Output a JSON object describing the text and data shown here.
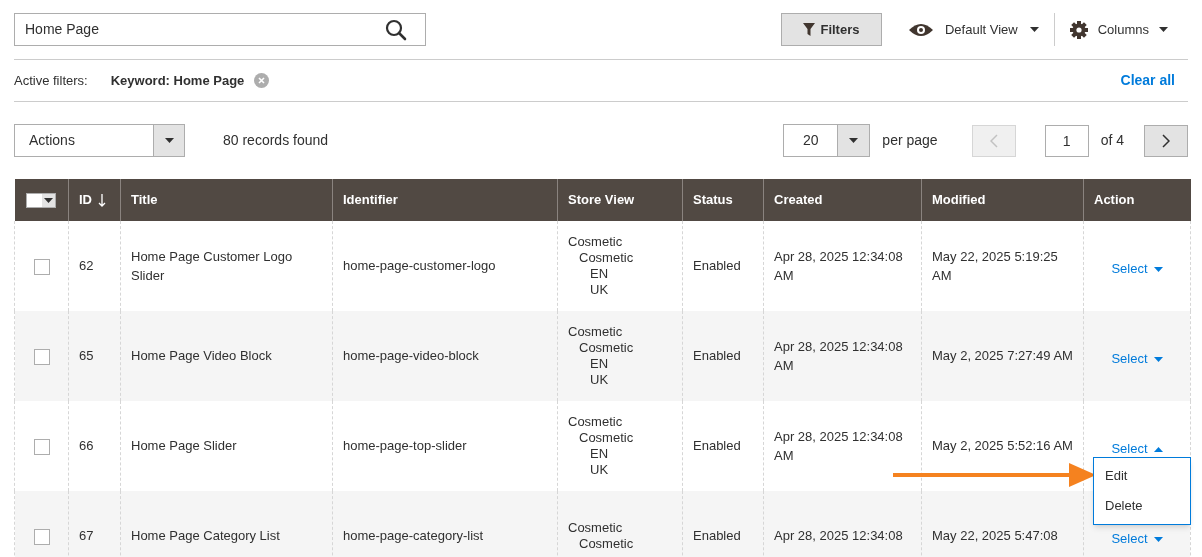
{
  "search": {
    "value": "Home Page"
  },
  "toolbar": {
    "filters": "Filters",
    "view": "Default View",
    "columns": "Columns"
  },
  "active_filters": {
    "label": "Active filters:",
    "chips": [
      {
        "text": "Keyword: Home Page"
      }
    ],
    "clear": "Clear all"
  },
  "actions": {
    "label": "Actions"
  },
  "records": "80 records found",
  "per_page": {
    "value": "20",
    "label": "per page"
  },
  "pager": {
    "prev_disabled": true,
    "next_disabled": false,
    "page": "1",
    "of": "of 4"
  },
  "table": {
    "select_all_checked": false,
    "columns": [
      {
        "label": "ID",
        "sorted": true
      },
      {
        "label": "Title",
        "sorted": false
      },
      {
        "label": "Identifier",
        "sorted": false
      },
      {
        "label": "Store View",
        "sorted": false
      },
      {
        "label": "Status",
        "sorted": false
      },
      {
        "label": "Created",
        "sorted": false
      },
      {
        "label": "Modified",
        "sorted": false
      },
      {
        "label": "Action",
        "sorted": false
      }
    ],
    "rows": [
      {
        "checked": false,
        "id": "62",
        "title": "Home Page Customer Logo Slider",
        "identifier": "home-page-customer-logo",
        "store_view": [
          {
            "label": "Cosmetic",
            "children": [
              {
                "label": "Cosmetic",
                "children": [
                  {
                    "label": "EN"
                  },
                  {
                    "label": "UK"
                  }
                ]
              }
            ]
          }
        ],
        "status": "Enabled",
        "created": "Apr 28, 2025 12:34:08 AM",
        "modified": "May 22, 2025 5:19:25 AM",
        "action": {
          "label": "Select",
          "open": false
        }
      },
      {
        "checked": false,
        "id": "65",
        "title": "Home Page Video Block",
        "identifier": "home-page-video-block",
        "store_view": [
          {
            "label": "Cosmetic",
            "children": [
              {
                "label": "Cosmetic",
                "children": [
                  {
                    "label": "EN"
                  },
                  {
                    "label": "UK"
                  }
                ]
              }
            ]
          }
        ],
        "status": "Enabled",
        "created": "Apr 28, 2025 12:34:08 AM",
        "modified": "May 2, 2025 7:27:49 AM",
        "action": {
          "label": "Select",
          "open": false
        }
      },
      {
        "checked": false,
        "id": "66",
        "title": "Home Page Slider",
        "identifier": "home-page-top-slider",
        "store_view": [
          {
            "label": "Cosmetic",
            "children": [
              {
                "label": "Cosmetic",
                "children": [
                  {
                    "label": "EN"
                  },
                  {
                    "label": "UK"
                  }
                ]
              }
            ]
          }
        ],
        "status": "Enabled",
        "created": "Apr 28, 2025 12:34:08 AM",
        "modified": "May 2, 2025 5:52:16 AM",
        "action": {
          "label": "Select",
          "open": true,
          "menu": [
            "Edit",
            "Delete"
          ]
        }
      },
      {
        "checked": false,
        "id": "67",
        "title": "Home Page Category List",
        "identifier": "home-page-category-list",
        "store_view": [
          {
            "label": "Cosmetic",
            "children": [
              {
                "label": "Cosmetic"
              }
            ]
          }
        ],
        "status": "Enabled",
        "created": "Apr 28, 2025 12:34:08",
        "modified": "May 22, 2025 5:47:08",
        "action": {
          "label": "Select",
          "open": false
        }
      }
    ]
  }
}
